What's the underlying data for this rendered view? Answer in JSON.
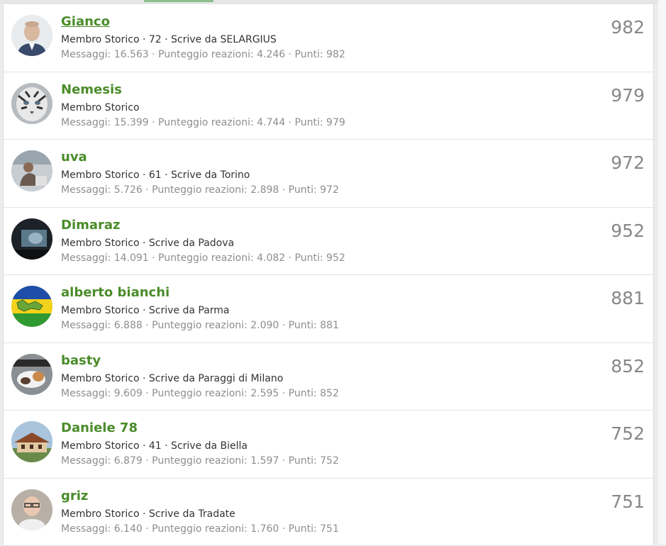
{
  "members": [
    {
      "name": "Gianco",
      "info": "Membro Storico · 72 · Scrive da SELARGIUS",
      "stats": "Messaggi: 16.563 · Punteggio reazioni: 4.246 · Punti: 982",
      "points": "982",
      "avatar": "avatar-man-bald"
    },
    {
      "name": "Nemesis",
      "info": "Membro Storico",
      "stats": "Messaggi: 15.399 · Punteggio reazioni: 4.744 · Punti: 979",
      "points": "979",
      "avatar": "avatar-white-tiger"
    },
    {
      "name": "uva",
      "info": "Membro Storico · 61 · Scrive da Torino",
      "stats": "Messaggi: 5.726 · Punteggio reazioni: 2.898 · Punti: 972",
      "points": "972",
      "avatar": "avatar-person-seated"
    },
    {
      "name": "Dimaraz",
      "info": "Membro Storico · Scrive da Padova",
      "stats": "Messaggi: 14.091 · Punteggio reazioni: 4.082 · Punti: 952",
      "points": "952",
      "avatar": "avatar-dark-screen"
    },
    {
      "name": "alberto bianchi",
      "info": "Membro Storico · Scrive da Parma",
      "stats": "Messaggi: 6.888 · Punteggio reazioni: 2.090 · Punti: 881",
      "points": "881",
      "avatar": "avatar-flag-blue-yellow-green"
    },
    {
      "name": "basty",
      "info": "Membro Storico · Scrive da Paraggi di Milano",
      "stats": "Messaggi: 9.609 · Punteggio reazioni: 2.595 · Punti: 852",
      "points": "852",
      "avatar": "avatar-cat"
    },
    {
      "name": "Daniele 78",
      "info": "Membro Storico · 41 · Scrive da Biella",
      "stats": "Messaggi: 6.879 · Punteggio reazioni: 1.597 · Punti: 752",
      "points": "752",
      "avatar": "avatar-house"
    },
    {
      "name": "griz",
      "info": "Membro Storico · Scrive da Tradate",
      "stats": "Messaggi: 6.140 · Punteggio reazioni: 1.760 · Punti: 751",
      "points": "751",
      "avatar": "avatar-man-glasses"
    }
  ],
  "colors": {
    "name": "#4a8c2a",
    "info": "#333333",
    "stats": "#8e8e8e",
    "points": "#888888"
  }
}
